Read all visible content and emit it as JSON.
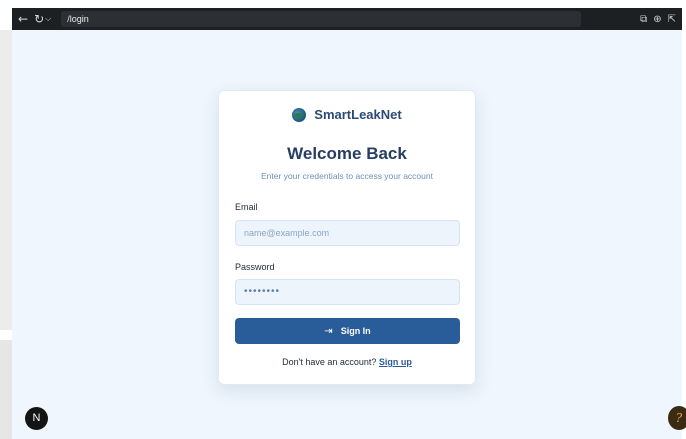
{
  "browser": {
    "url": "/login",
    "back_icon": "←",
    "reload_icon": "↻",
    "reload_menu_icon": "⌵",
    "right_icons": [
      "⧉",
      "⊕",
      "⇱"
    ]
  },
  "brand": {
    "name": "SmartLeakNet",
    "logo_icon": "globe-icon"
  },
  "form": {
    "title": "Welcome Back",
    "subtitle": "Enter your credentials to access your account",
    "email_label": "Email",
    "email_placeholder": "name@example.com",
    "password_label": "Password",
    "password_value": "••••••••",
    "signin_icon": "⇥",
    "signin_label": "Sign In",
    "footer_prompt": "Don't have an account?",
    "signup_link": "Sign up"
  },
  "badges": {
    "n_badge": "N",
    "help_bubble": "?"
  },
  "colors": {
    "primary": "#295d9a",
    "background": "#eff6fd",
    "title": "#273e63"
  }
}
